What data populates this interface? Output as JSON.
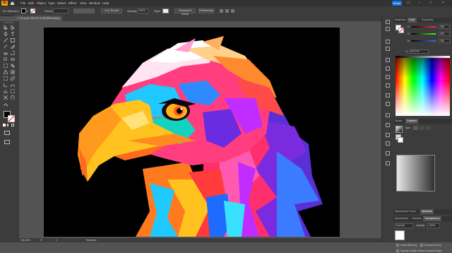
{
  "app": {
    "logo": "Ai",
    "share_label": "Share"
  },
  "menubar": {
    "items": [
      "File",
      "Edit",
      "Object",
      "Type",
      "Select",
      "Effect",
      "View",
      "Window",
      "Help"
    ]
  },
  "controlbar": {
    "selection_label": "No Selection",
    "stroke_label": "Stroke",
    "brush_label": "3 pt. Round",
    "opacity_label": "Opacity",
    "opacity_value": "100%",
    "style_label": "Style",
    "document_setup_label": "Document Setup",
    "preferences_label": "Preferences"
  },
  "document": {
    "tab_title": "× **2.ai @ 106.16 % (RGB/Preview)"
  },
  "statusbar": {
    "zoom": "106.16%",
    "rotation": "0°",
    "artboard": "1",
    "tool": "Selection"
  },
  "panels": {
    "color_tabs": [
      "Swatches",
      "Color",
      "Properties"
    ],
    "color_active": "Color",
    "color_sliders": [
      {
        "label": "R",
        "value": "255",
        "color": "#ff3b3b"
      },
      {
        "label": "G",
        "value": "255",
        "color": "#3bff3b"
      },
      {
        "label": "B",
        "value": "255",
        "color": "#3b6bff"
      }
    ],
    "color_hex_label": "#",
    "color_hex_value": "FFFFFF",
    "gradient_tabs": [
      "Stroke",
      "Gradient"
    ],
    "gradient_active": "Gradient",
    "gradient_type_label": "Type",
    "transparency_tabs_1": [
      "Appearance Panel",
      "Attributes"
    ],
    "transparency_tabs_2": [
      "Appearance",
      "Libraries",
      "Transparency"
    ],
    "transparency_active": "Transparency",
    "blend_mode": "Normal",
    "opacity_label": "Opacity",
    "opacity_value": "100%",
    "isolate_blending": "Isolate Blending",
    "knockout_group": "Knockout Group",
    "opacity_mask": "Opacity & Mask Define Knockout Shape"
  },
  "colors": {
    "accent": "#1473e6",
    "logo": "#ff9a00",
    "chrome": "#3c3c3c",
    "panel_dark": "#323232"
  },
  "icons": [
    "home-icon",
    "arrow-icon",
    "direct-select-icon",
    "pen-icon",
    "type-icon",
    "line-icon",
    "rectangle-icon",
    "brush-icon",
    "pencil-icon",
    "eraser-icon",
    "rotate-icon",
    "scale-icon",
    "warp-icon",
    "free-transform-icon",
    "shape-builder-icon",
    "perspective-icon",
    "mesh-icon",
    "gradient-icon",
    "eyedropper-icon",
    "blend-icon",
    "symbol-icon",
    "graph-icon",
    "artboard-icon",
    "slice-icon",
    "hand-icon",
    "zoom-icon"
  ]
}
